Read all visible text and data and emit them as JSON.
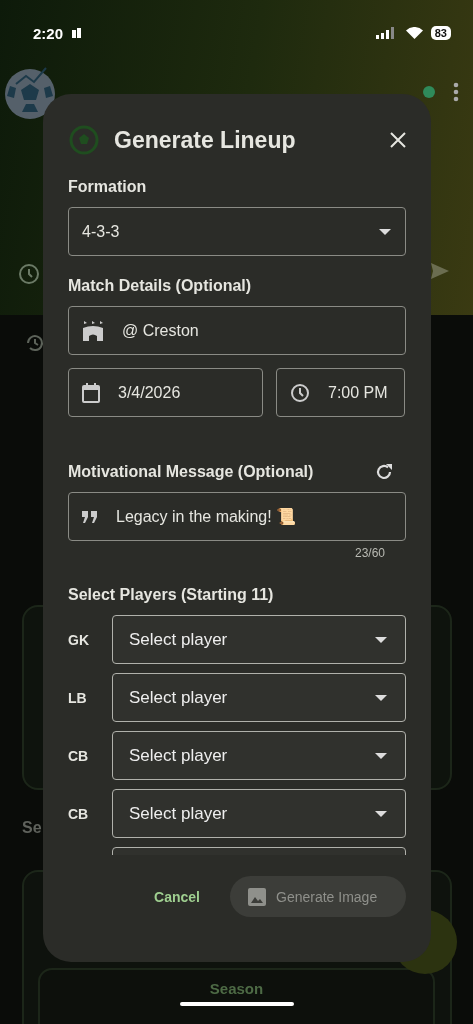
{
  "status_bar": {
    "time": "2:20",
    "battery": "83"
  },
  "background": {
    "section_label": "Se",
    "season_label": "Season"
  },
  "dialog": {
    "title": "Generate Lineup",
    "formation": {
      "label": "Formation",
      "value": "4-3-3"
    },
    "match_details": {
      "label": "Match Details (Optional)",
      "venue": "@ Creston",
      "date": "3/4/2026",
      "time": "7:00 PM"
    },
    "message": {
      "label": "Motivational Message (Optional)",
      "value": "Legacy in the making! 📜",
      "counter": "23/60"
    },
    "players": {
      "label": "Select Players (Starting 11)",
      "rows": [
        {
          "position": "GK",
          "placeholder": "Select player"
        },
        {
          "position": "LB",
          "placeholder": "Select player"
        },
        {
          "position": "CB",
          "placeholder": "Select player"
        },
        {
          "position": "CB",
          "placeholder": "Select player"
        }
      ]
    },
    "actions": {
      "cancel": "Cancel",
      "generate": {
        "label": "Generate Image",
        "disabled": true
      }
    }
  }
}
